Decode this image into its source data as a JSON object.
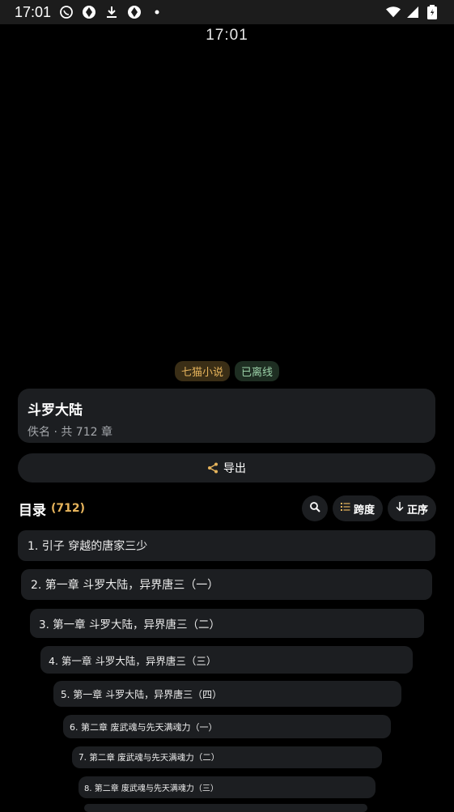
{
  "status_bar": {
    "time": "17:01",
    "icons": [
      "whatsapp-icon",
      "aperture-icon",
      "download-icon",
      "aperture-icon",
      "dot-icon"
    ],
    "right_icons": [
      "wifi-icon",
      "signal-icon",
      "battery-icon"
    ]
  },
  "clock": "17:01",
  "badges": {
    "source": "七猫小说",
    "status": "已离线"
  },
  "book": {
    "title": "斗罗大陆",
    "meta": "佚名 · 共 712 章"
  },
  "export": {
    "label": "导出",
    "icon": "share-icon"
  },
  "toc": {
    "title": "目录",
    "count": "(712)",
    "search_icon": "search-icon",
    "jump_label": "跨度",
    "order_label": "正序",
    "chapters": [
      "1. 引子 穿越的唐家三少",
      "2. 第一章 斗罗大陆，异界唐三（一）",
      "3. 第一章 斗罗大陆，异界唐三（二）",
      "4. 第一章 斗罗大陆，异界唐三（三）",
      "5. 第一章 斗罗大陆，异界唐三（四）",
      "6. 第二章 废武魂与先天满魂力（一）",
      "7. 第二章 废武魂与先天满魂力（二）",
      "8. 第二章 废武魂与先天满魂力（三）"
    ]
  },
  "colors": {
    "background": "#000000",
    "card": "#1c1e21",
    "accent": "#e6b45c",
    "offline": "#9bd1a8"
  }
}
